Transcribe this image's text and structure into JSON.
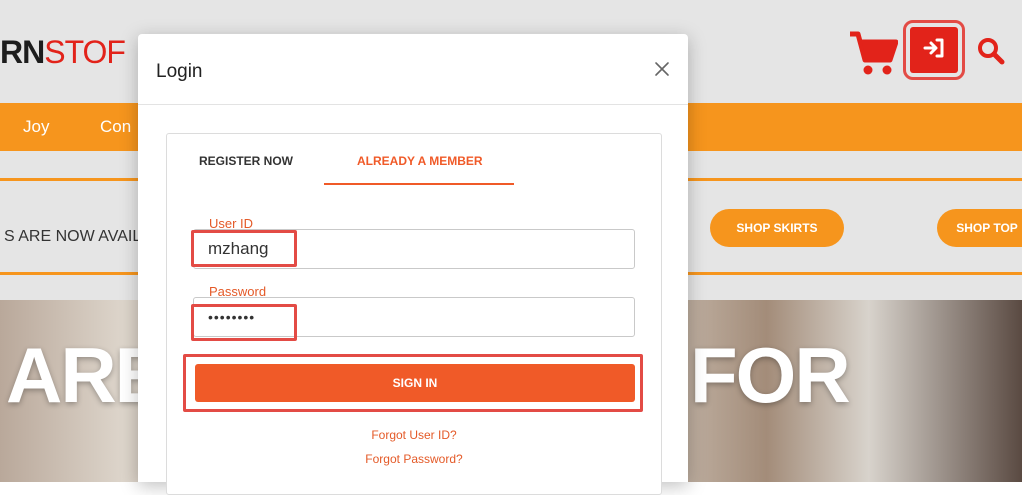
{
  "site": {
    "logo_bold": "RN",
    "logo_red": "STOF",
    "nav": [
      "Joy",
      "Con"
    ],
    "promo_text": "S ARE NOW AVAIL",
    "pills": [
      "SHOP SKIRTS",
      "SHOP TOP"
    ],
    "hero_left": "ARE",
    "hero_right": "FOR"
  },
  "modal": {
    "title": "Login",
    "tabs": {
      "register": "REGISTER NOW",
      "member": "ALREADY A MEMBER"
    },
    "user_id_label": "User ID",
    "user_id_value": "mzhang",
    "password_label": "Password",
    "password_value": "••••••••",
    "signin_label": "SIGN IN",
    "forgot_user": "Forgot User ID?",
    "forgot_password": "Forgot Password?"
  },
  "colors": {
    "brand_orange": "#f6951d",
    "accent_orange": "#f05a28",
    "brand_red": "#e2231a",
    "highlight": "#e34b45"
  },
  "icons": [
    "cart-icon",
    "sign-in-icon",
    "search-icon",
    "close-icon"
  ]
}
